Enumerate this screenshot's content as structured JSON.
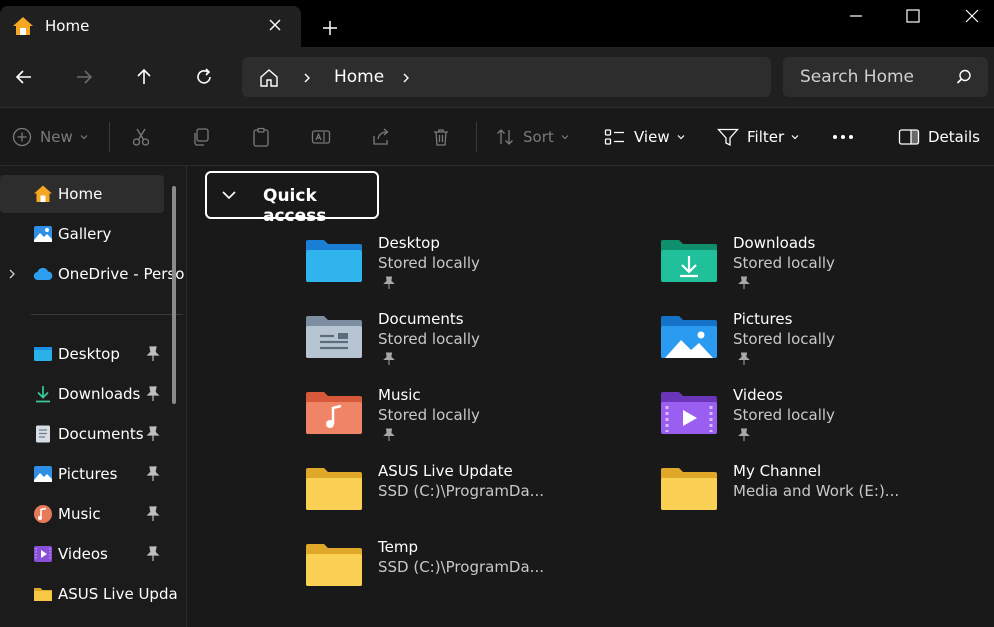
{
  "window": {
    "tab_title": "Home",
    "tab_icon": "home-icon"
  },
  "navbar": {
    "breadcrumb": "Home",
    "search_placeholder": "Search Home"
  },
  "toolbar": {
    "new_label": "New",
    "sort_label": "Sort",
    "view_label": "View",
    "filter_label": "Filter",
    "details_label": "Details"
  },
  "sidebar": {
    "items": [
      {
        "label": "Home",
        "icon": "home-icon",
        "selected": true
      },
      {
        "label": "Gallery",
        "icon": "gallery-icon"
      },
      {
        "label": "OneDrive - Perso",
        "icon": "onedrive-icon"
      },
      {
        "label": "Desktop",
        "icon": "desktop-folder-icon",
        "pinned": true
      },
      {
        "label": "Downloads",
        "icon": "download-icon",
        "pinned": true
      },
      {
        "label": "Documents",
        "icon": "documents-icon",
        "pinned": true
      },
      {
        "label": "Pictures",
        "icon": "pictures-icon",
        "pinned": true
      },
      {
        "label": "Music",
        "icon": "music-icon",
        "pinned": true
      },
      {
        "label": "Videos",
        "icon": "videos-icon",
        "pinned": true
      },
      {
        "label": "ASUS Live Upda",
        "icon": "folder-icon"
      }
    ]
  },
  "quick_access": {
    "title": "Quick access",
    "items": [
      {
        "name": "Desktop",
        "sub": "Stored locally",
        "icon": "desktop-folder-icon",
        "pinned": true
      },
      {
        "name": "Downloads",
        "sub": "Stored locally",
        "icon": "downloads-folder-icon",
        "pinned": true
      },
      {
        "name": "Documents",
        "sub": "Stored locally",
        "icon": "documents-folder-icon",
        "pinned": true
      },
      {
        "name": "Pictures",
        "sub": "Stored locally",
        "icon": "pictures-folder-icon",
        "pinned": true
      },
      {
        "name": "Music",
        "sub": "Stored locally",
        "icon": "music-folder-icon",
        "pinned": true
      },
      {
        "name": "Videos",
        "sub": "Stored locally",
        "icon": "videos-folder-icon",
        "pinned": true
      },
      {
        "name": "ASUS Live Update",
        "sub": "SSD (C:)\\ProgramDa...",
        "icon": "folder-icon"
      },
      {
        "name": "My Channel",
        "sub": "Media and Work (E:)...",
        "icon": "folder-icon"
      },
      {
        "name": "Temp",
        "sub": "SSD (C:)\\ProgramDa...",
        "icon": "folder-icon"
      }
    ]
  },
  "colors": {
    "background": "#191919",
    "titlebar": "#000000",
    "panel": "#202020",
    "folder_yellow": "#f8c845",
    "accent_blue": "#1a8fe3"
  }
}
